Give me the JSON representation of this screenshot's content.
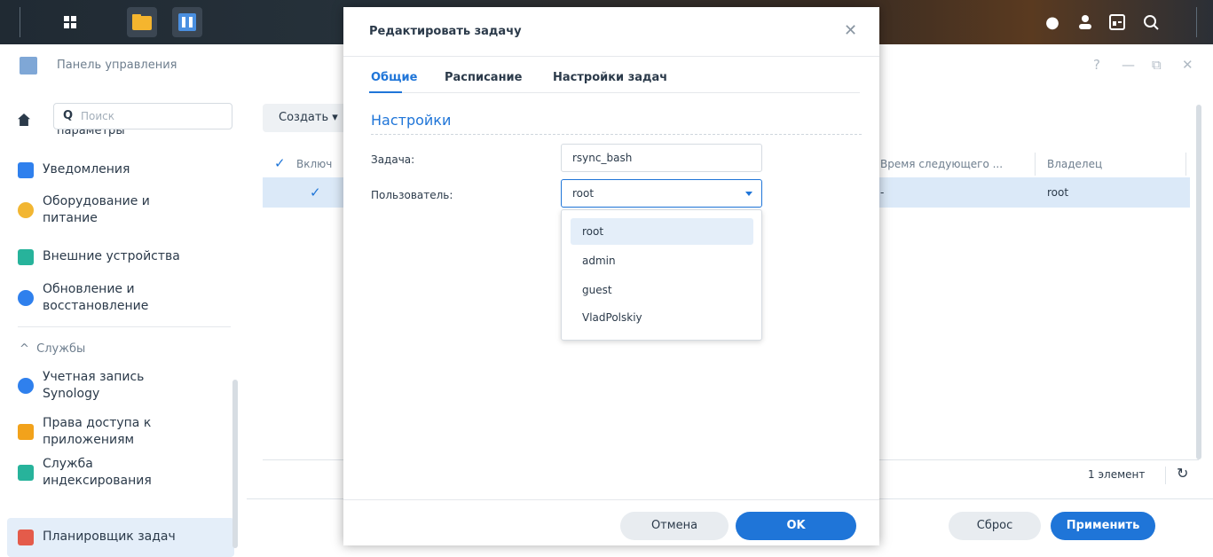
{
  "control_panel": {
    "title": "Панель управления",
    "window_controls": [
      "?",
      "—",
      "⧉",
      "✕"
    ]
  },
  "sidebar": {
    "search_placeholder": "Поиск",
    "cut_item": "параметры",
    "items": [
      {
        "label": "Уведомления",
        "icon": "notifications-icon",
        "color": "#2f80ed"
      },
      {
        "label": "Оборудование и",
        "label2": "питание",
        "icon": "bulb-icon",
        "color": "#f2b632"
      },
      {
        "label": "Внешние устройства",
        "icon": "external-device-icon",
        "color": "#27b39b"
      },
      {
        "label": "Обновление и",
        "label2": "восстановление",
        "icon": "update-icon",
        "color": "#2f80ed"
      }
    ],
    "services_header": "Службы",
    "service_items": [
      {
        "label": "Учетная запись",
        "label2": "Synology",
        "icon": "synology-account-icon",
        "color": "#2f80ed"
      },
      {
        "label": "Права доступа к",
        "label2": "приложениям",
        "icon": "lock-icon",
        "color": "#f2a21b"
      },
      {
        "label": "Служба",
        "label2": "индексирования",
        "icon": "indexing-icon",
        "color": "#27b39b"
      },
      {
        "label": "Планировщик задач",
        "icon": "calendar-icon",
        "color": "#e45b4a"
      }
    ]
  },
  "main": {
    "create_button": "Создать",
    "columns": {
      "enabled": "Включ",
      "next_run": "Время следующего ...",
      "owner": "Владелец"
    },
    "row": {
      "next_run": "-",
      "owner": "root"
    },
    "count": "1 элемент",
    "reset": "Сброс",
    "apply": "Применить"
  },
  "dialog": {
    "title": "Редактировать задачу",
    "tabs": [
      "Общие",
      "Расписание",
      "Настройки задач"
    ],
    "section": "Настройки",
    "task_label": "Задача:",
    "task_value": "rsync_bash",
    "user_label": "Пользователь:",
    "user_value": "root",
    "user_options": [
      "root",
      "admin",
      "guest",
      "VladPolskiy"
    ],
    "cancel": "Отмена",
    "ok": "OK"
  },
  "colors": {
    "accent": "#1f75d8"
  }
}
